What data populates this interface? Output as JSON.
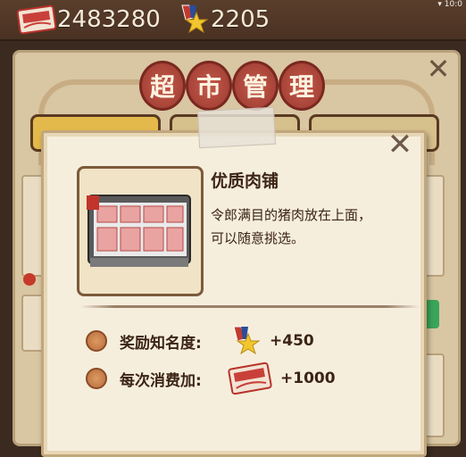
{
  "topbar": {
    "ticket_icon": "coupon-ticket-icon",
    "ticket_count": "2483280",
    "fame_icon": "medal-star-icon",
    "fame_count": "2205",
    "clock": "10:0"
  },
  "board": {
    "title_chars": [
      "超",
      "市",
      "管",
      "理"
    ],
    "close_icon": "close-x-icon"
  },
  "popup": {
    "close_icon": "close-x-icon",
    "shop_name": "优质肉铺",
    "description": "令郎满目的猪肉放在上面，可以随意挑选。",
    "thumb_icon": "meat-display-counter-image",
    "rewards": [
      {
        "label": "奖励知名度:",
        "icon": "medal-star-icon",
        "value": "+450"
      },
      {
        "label": "每次消费加:",
        "icon": "coupon-ticket-icon",
        "value": "+1000"
      }
    ]
  },
  "colors": {
    "accent_red": "#a8443a",
    "paper": "#f6eedd",
    "text_dark": "#3b2414",
    "tab_gold": "#e4b94c"
  }
}
